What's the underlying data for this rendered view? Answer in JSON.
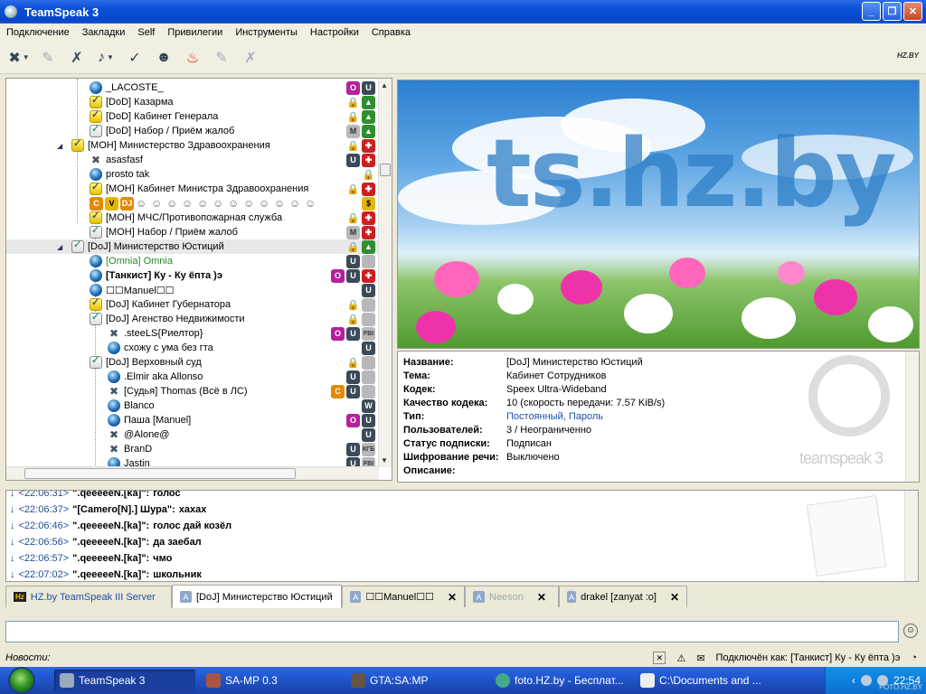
{
  "window": {
    "title": "TeamSpeak 3"
  },
  "menu": [
    "Подключение",
    "Закладки",
    "Self",
    "Привилегии",
    "Инструменты",
    "Настройки",
    "Справка"
  ],
  "toolbar": {
    "icons": [
      "disconnect-icon",
      "connect-icon",
      "mute-mic-icon",
      "mute-speakers-icon",
      "away-icon",
      "contacts-icon",
      "flame-icon",
      "whisper-icon",
      "record-icon"
    ],
    "logo": "HZ.BY"
  },
  "tree": {
    "rows": [
      {
        "label": "_LACOSTE_",
        "kind": "user",
        "indent": 92,
        "badges": [
          "O",
          "U"
        ]
      },
      {
        "label": "[DoD] Казарма",
        "kind": "channel-yellow",
        "indent": 92,
        "badges": [
          "lock",
          "G"
        ]
      },
      {
        "label": "[DoD] Кабинет Генерала",
        "kind": "channel-yellow",
        "indent": 92,
        "badges": [
          "lock",
          "G"
        ]
      },
      {
        "label": "[DoD] Набор / Приём жалоб",
        "kind": "channel",
        "indent": 92,
        "badges": [
          "M",
          "G"
        ]
      },
      {
        "label": "[МОН] Министерство Здравоохранения",
        "kind": "channel-yellow",
        "indent": 72,
        "badges": [
          "lock",
          "red"
        ]
      },
      {
        "label": "asasfasf",
        "kind": "mute",
        "indent": 92,
        "badges": [
          "U",
          "red"
        ]
      },
      {
        "label": "prosto tak",
        "kind": "user",
        "indent": 92,
        "badges": [
          "lock"
        ]
      },
      {
        "label": "[МОН] Кабинет Министра Здравоохранения",
        "kind": "channel-yellow",
        "indent": 92,
        "badges": [
          "lock",
          "red"
        ]
      },
      {
        "label": "",
        "kind": "emojis",
        "indent": 92,
        "badges": [
          "$"
        ]
      },
      {
        "label": "[МОН] МЧС/Противопожарная служба",
        "kind": "channel-yellow",
        "indent": 92,
        "badges": [
          "lock",
          "red"
        ]
      },
      {
        "label": "[МОН] Набор / Приём жалоб",
        "kind": "channel",
        "indent": 92,
        "badges": [
          "M",
          "red"
        ]
      },
      {
        "label": "[DoJ] Министерство Юстиций",
        "kind": "channel",
        "indent": 72,
        "badges": [
          "lock",
          "G"
        ],
        "selected": true
      },
      {
        "label": "[Omnia] Omnia",
        "kind": "user-green",
        "indent": 92,
        "badges": [
          "U",
          "gray"
        ]
      },
      {
        "label": "[Танкист] Ку - Ку ёпта )э",
        "kind": "user-bold",
        "indent": 92,
        "badges": [
          "O",
          "U",
          "red"
        ]
      },
      {
        "label": "☐☐Manuel☐☐",
        "kind": "user",
        "indent": 92,
        "badges": [
          "U"
        ]
      },
      {
        "label": "[DoJ] Кабинет Губернатора",
        "kind": "channel-yellow",
        "indent": 92,
        "badges": [
          "lock",
          "gray"
        ]
      },
      {
        "label": "[DoJ] Агенство Недвижимости",
        "kind": "channel",
        "indent": 92,
        "badges": [
          "lock",
          "gray"
        ]
      },
      {
        "label": ".steeLS{Риелтор}",
        "kind": "mute",
        "indent": 112,
        "badges": [
          "O",
          "U",
          "FBI"
        ]
      },
      {
        "label": "схожу с ума без гта",
        "kind": "user",
        "indent": 112,
        "badges": [
          "U"
        ]
      },
      {
        "label": "[DoJ] Верховный суд",
        "kind": "channel",
        "indent": 92,
        "badges": [
          "lock",
          "gray"
        ]
      },
      {
        "label": ".Elmir aka Allonso",
        "kind": "user",
        "indent": 112,
        "badges": [
          "U",
          "gray"
        ]
      },
      {
        "label": "[Судья] Thomas (Всё в ЛС)",
        "kind": "mute",
        "indent": 112,
        "badges": [
          "C",
          "U",
          "gray"
        ]
      },
      {
        "label": "Blanco",
        "kind": "user",
        "indent": 112,
        "badges": [
          "W"
        ]
      },
      {
        "label": "Паша [Manuel]",
        "kind": "user",
        "indent": 112,
        "badges": [
          "O",
          "U"
        ]
      },
      {
        "label": "@Alone@",
        "kind": "mute",
        "indent": 112,
        "badges": [
          "U"
        ]
      },
      {
        "label": "BranD",
        "kind": "mute",
        "indent": 112,
        "badges": [
          "U",
          "КГБ"
        ]
      },
      {
        "label": "Jastin",
        "kind": "user",
        "indent": 112,
        "badges": [
          "U",
          "FBI"
        ]
      }
    ]
  },
  "banner": {
    "logo_text": "ts.hz.by"
  },
  "info": {
    "fields": [
      {
        "key": "Название:",
        "value": "[DoJ] Министерство Юстиций"
      },
      {
        "key": "Тема:",
        "value": "Кабинет Сотрудников"
      },
      {
        "key": "Кодек:",
        "value": "Speex Ultra-Wideband"
      },
      {
        "key": "Качество кодека:",
        "value": "10 (скорость передачи: 7.57 KiB/s)"
      },
      {
        "key": "Тип:",
        "value": "Постоянный, Пароль",
        "link": true
      },
      {
        "key": "Пользователей:",
        "value": "3 / Неограниченно"
      },
      {
        "key": "Статус подписки:",
        "value": "Подписан"
      },
      {
        "key": "Шифрование речи:",
        "value": "Выключено"
      },
      {
        "key": "Описание:",
        "value": ""
      }
    ],
    "brand": "teamspeak 3"
  },
  "chat": {
    "messages": [
      {
        "time": "<22:06:31>",
        "nick": "\".qeeeeeN.[ka]\":",
        "text": "голос"
      },
      {
        "time": "<22:06:37>",
        "nick": "\"[Camero[N].] Шура\":",
        "text": "хахах"
      },
      {
        "time": "<22:06:46>",
        "nick": "\".qeeeeeN.[ka]\":",
        "text": "голос дай козёл"
      },
      {
        "time": "<22:06:56>",
        "nick": "\".qeeeeeN.[ka]\":",
        "text": "да заебал"
      },
      {
        "time": "<22:06:57>",
        "nick": "\".qeeeeeN.[ka]\":",
        "text": "чмо"
      },
      {
        "time": "<22:07:02>",
        "nick": "\".qeeeeeN.[ka]\":",
        "text": "школьник"
      }
    ]
  },
  "tabs": [
    {
      "label": "HZ.by TeamSpeak III Server",
      "type": "server"
    },
    {
      "label": "[DoJ] Министерство Юстиций",
      "type": "channel",
      "active": true
    },
    {
      "label": "☐☐Manuel☐☐",
      "type": "private",
      "close": "✕"
    },
    {
      "label": "Neeson",
      "type": "private-muted",
      "close": "✕"
    },
    {
      "label": "drakel [zanyat :o]",
      "type": "private",
      "close": "✕"
    }
  ],
  "statusbar": {
    "news": "Новости:",
    "connected": "Подключён как: [Танкист] Ку - Ку ёпта )э"
  },
  "taskbar": {
    "items": [
      {
        "label": "TeamSpeak 3",
        "active": true
      },
      {
        "label": "SA-MP 0.3"
      },
      {
        "label": "GTA:SA:MP"
      },
      {
        "label": "foto.HZ.by - Бесплат..."
      },
      {
        "label": "C:\\Documents and ..."
      }
    ],
    "clock": "22:54",
    "watermark": "FOTO.HZ.BY"
  }
}
